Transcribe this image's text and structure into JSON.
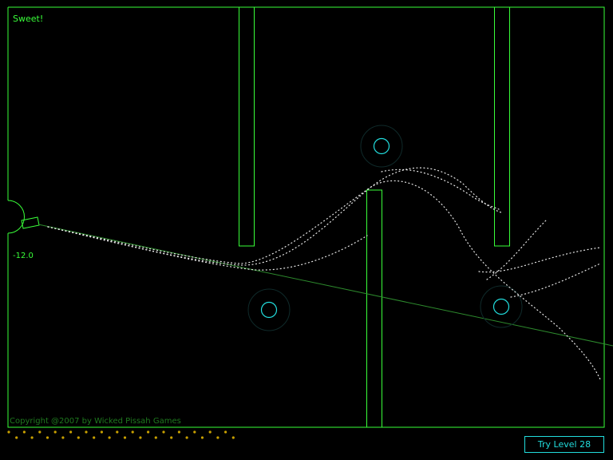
{
  "status_message": "Sweet!",
  "cannon_angle": "-12.0",
  "copyright": "Copyright @2007 by Wicked Pissah Games",
  "level_button_label": "Try Level 28",
  "shots_remaining": 30,
  "colors": {
    "walls": "#39ff39",
    "dim_green": "#1f7a1f",
    "targets": "#22dddd",
    "shot_dots": "#c8a000",
    "trail": "#ffffff"
  }
}
